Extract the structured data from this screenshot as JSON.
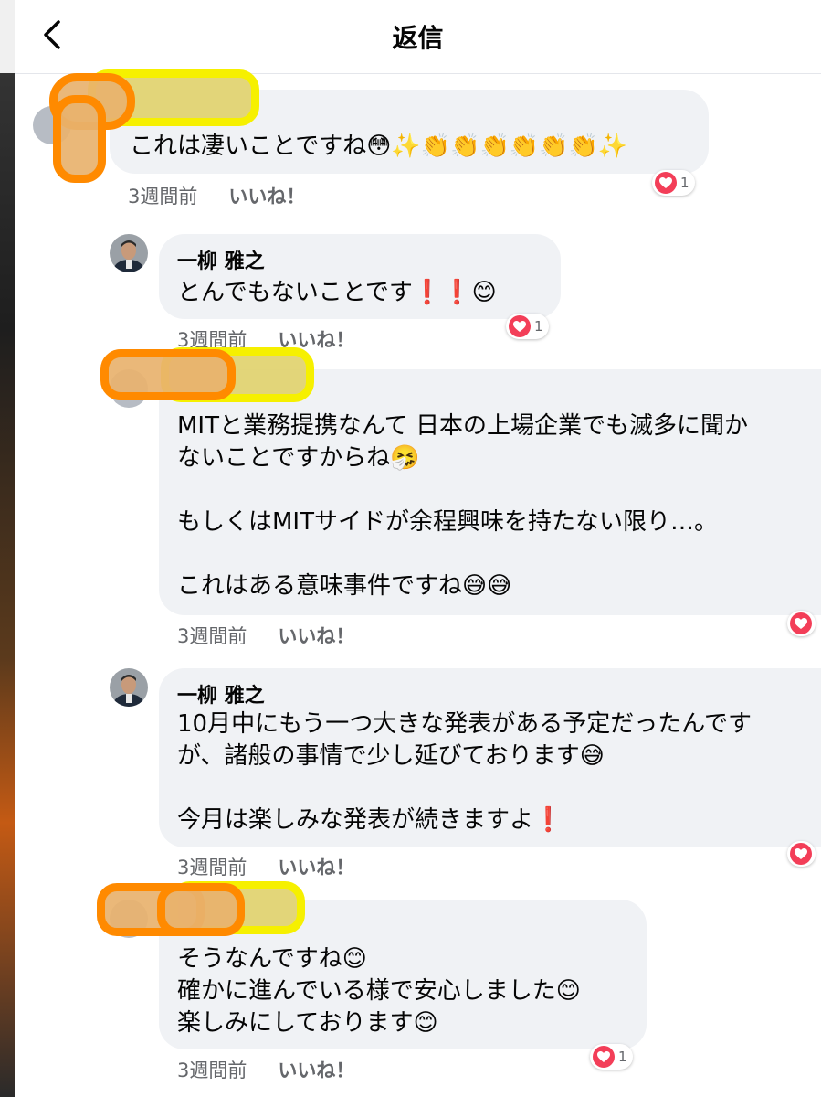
{
  "header": {
    "title": "返信",
    "back_icon": "chevron-left-icon"
  },
  "colors": {
    "like_red": "#f33e58",
    "bubble_bg": "#f0f2f5",
    "meta_gray": "#65676b",
    "redact_orange": "#ff8a00",
    "redact_yellow": "#f6f000"
  },
  "comments": [
    {
      "name": "",
      "text": "これは凄いことですね😳✨👏👏👏👏👏👏✨",
      "time": "3週間前",
      "like_label": "いいね！",
      "reaction_count": "1"
    },
    {
      "name": "一柳 雅之",
      "text": "とんでもないことです❗❗😊",
      "time": "3週間前",
      "like_label": "いいね！",
      "reaction_count": "1"
    },
    {
      "name": "",
      "text": "MITと業務提携なんて 日本の上場企業でも滅多に聞か\nないことですからね🤧\n\nもしくはMITサイドが余程興味を持たない限り…。\n\nこれはある意味事件ですね😅😅",
      "time": "3週間前",
      "like_label": "いいね！",
      "reaction_count": ""
    },
    {
      "name": "一柳 雅之",
      "text": "10月中にもう一つ大きな発表がある予定だったんです\nが、諸般の事情で少し延びております😅\n\n今月は楽しみな発表が続きますよ❗",
      "time": "3週間前",
      "like_label": "いいね！",
      "reaction_count": ""
    },
    {
      "name": "",
      "text": "そうなんですね😊\n確かに進んでいる様で安心しました😊\n楽しみにしております😊",
      "time": "3週間前",
      "like_label": "いいね！",
      "reaction_count": "1"
    }
  ]
}
